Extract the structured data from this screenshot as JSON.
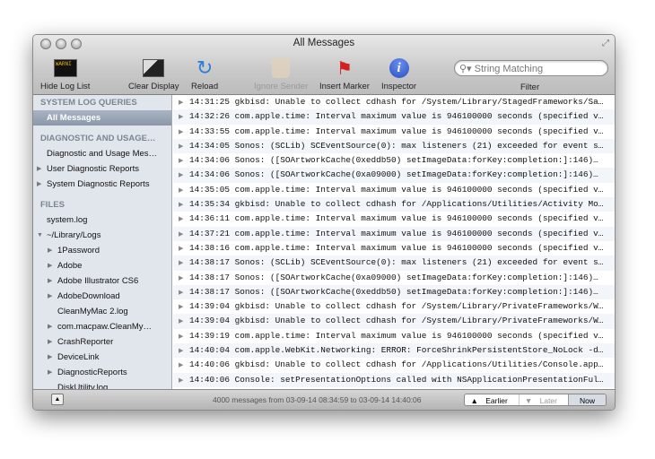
{
  "window": {
    "title": "All Messages"
  },
  "toolbar": {
    "hide_log_list": "Hide Log List",
    "clear_display": "Clear Display",
    "reload": "Reload",
    "ignore_sender": "Ignore Sender",
    "insert_marker": "Insert Marker",
    "inspector": "Inspector",
    "search_placeholder": "String Matching",
    "filter_label": "Filter",
    "log_icon_text": "WARNI"
  },
  "sidebar": {
    "system_header": "SYSTEM LOG QUERIES",
    "all_messages": "All Messages",
    "diag_header": "DIAGNOSTIC AND USAGE…",
    "diag_items": [
      "Diagnostic and Usage Mes…",
      "User Diagnostic Reports",
      "System Diagnostic Reports"
    ],
    "files_header": "FILES",
    "system_log": "system.log",
    "library_logs": "~/Library/Logs",
    "lib_items": [
      "1Password",
      "Adobe",
      "Adobe Illustrator CS6",
      "AdobeDownload",
      "CleanMyMac 2.log",
      "com.macpaw.CleanMy…",
      "CrashReporter",
      "DeviceLink",
      "DiagnosticReports",
      "DiskUtility.log"
    ]
  },
  "messages": [
    "14:31:25 gkbisd: Unable to collect cdhash for /System/Library/StagedFrameworks/Sa…",
    "14:32:26 com.apple.time: Interval maximum value is 946100000 seconds (specified v…",
    "14:33:55 com.apple.time: Interval maximum value is 946100000 seconds (specified v…",
    "14:34:05 Sonos: (SCLib) SCEventSource(0): max listeners (21) exceeded for event s…",
    "14:34:06 Sonos: ([SOArtworkCache(0xeddb50) setImageData:forKey:completion:]:146)…",
    "14:34:06 Sonos: ([SOArtworkCache(0xa09000) setImageData:forKey:completion:]:146)…",
    "14:35:05 com.apple.time: Interval maximum value is 946100000 seconds (specified v…",
    "14:35:34 gkbisd: Unable to collect cdhash for /Applications/Utilities/Activity Mo…",
    "14:36:11 com.apple.time: Interval maximum value is 946100000 seconds (specified v…",
    "14:37:21 com.apple.time: Interval maximum value is 946100000 seconds (specified v…",
    "14:38:16 com.apple.time: Interval maximum value is 946100000 seconds (specified v…",
    "14:38:17 Sonos: (SCLib) SCEventSource(0): max listeners (21) exceeded for event s…",
    "14:38:17 Sonos: ([SOArtworkCache(0xa09000) setImageData:forKey:completion:]:146)…",
    "14:38:17 Sonos: ([SOArtworkCache(0xeddb50) setImageData:forKey:completion:]:146)…",
    "14:39:04 gkbisd: Unable to collect cdhash for /System/Library/PrivateFrameworks/W…",
    "14:39:04 gkbisd: Unable to collect cdhash for /System/Library/PrivateFrameworks/W…",
    "14:39:19 com.apple.time: Interval maximum value is 946100000 seconds (specified v…",
    "14:40:04 com.apple.WebKit.Networking: ERROR: ForceShrinkPersistentStore_NoLock -d…",
    "14:40:06 gkbisd: Unable to collect cdhash for /Applications/Utilities/Console.app…",
    "14:40:06 Console: setPresentationOptions called with NSApplicationPresentationFul…"
  ],
  "statusbar": {
    "text": "4000 messages from 03-09-14 08:34:59 to 03-09-14 14:40:06",
    "earlier": "Earlier",
    "later": "Later",
    "now": "Now"
  }
}
